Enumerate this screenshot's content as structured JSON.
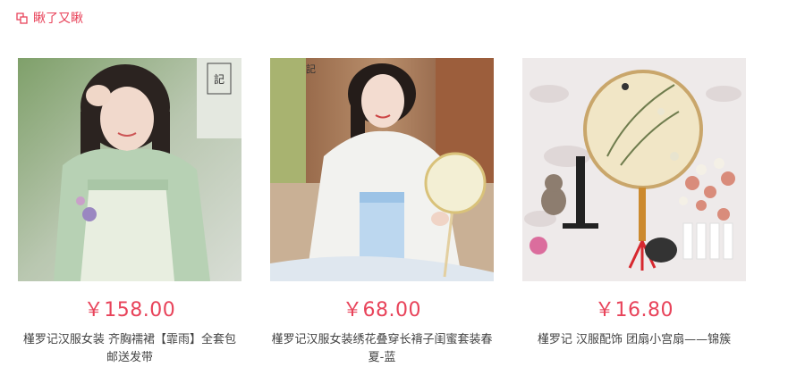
{
  "header": {
    "title": "瞅了又瞅",
    "icon": "recommend-icon"
  },
  "products": [
    {
      "price": "￥158.00",
      "name": "槿罗记汉服女装 齐胸襦裙【霏雨】全套包邮送发带",
      "image": "hanfu-green-model-photo"
    },
    {
      "price": "￥68.00",
      "name": "槿罗记汉服女装绣花叠穿长褙子闺蜜套装春夏-蓝",
      "image": "hanfu-white-blue-model-photo"
    },
    {
      "price": "￥16.80",
      "name": "槿罗记 汉服配饰 团扇小宫扇——锦簇",
      "image": "round-fan-product-photo"
    }
  ],
  "colors": {
    "accent": "#e8435a"
  }
}
